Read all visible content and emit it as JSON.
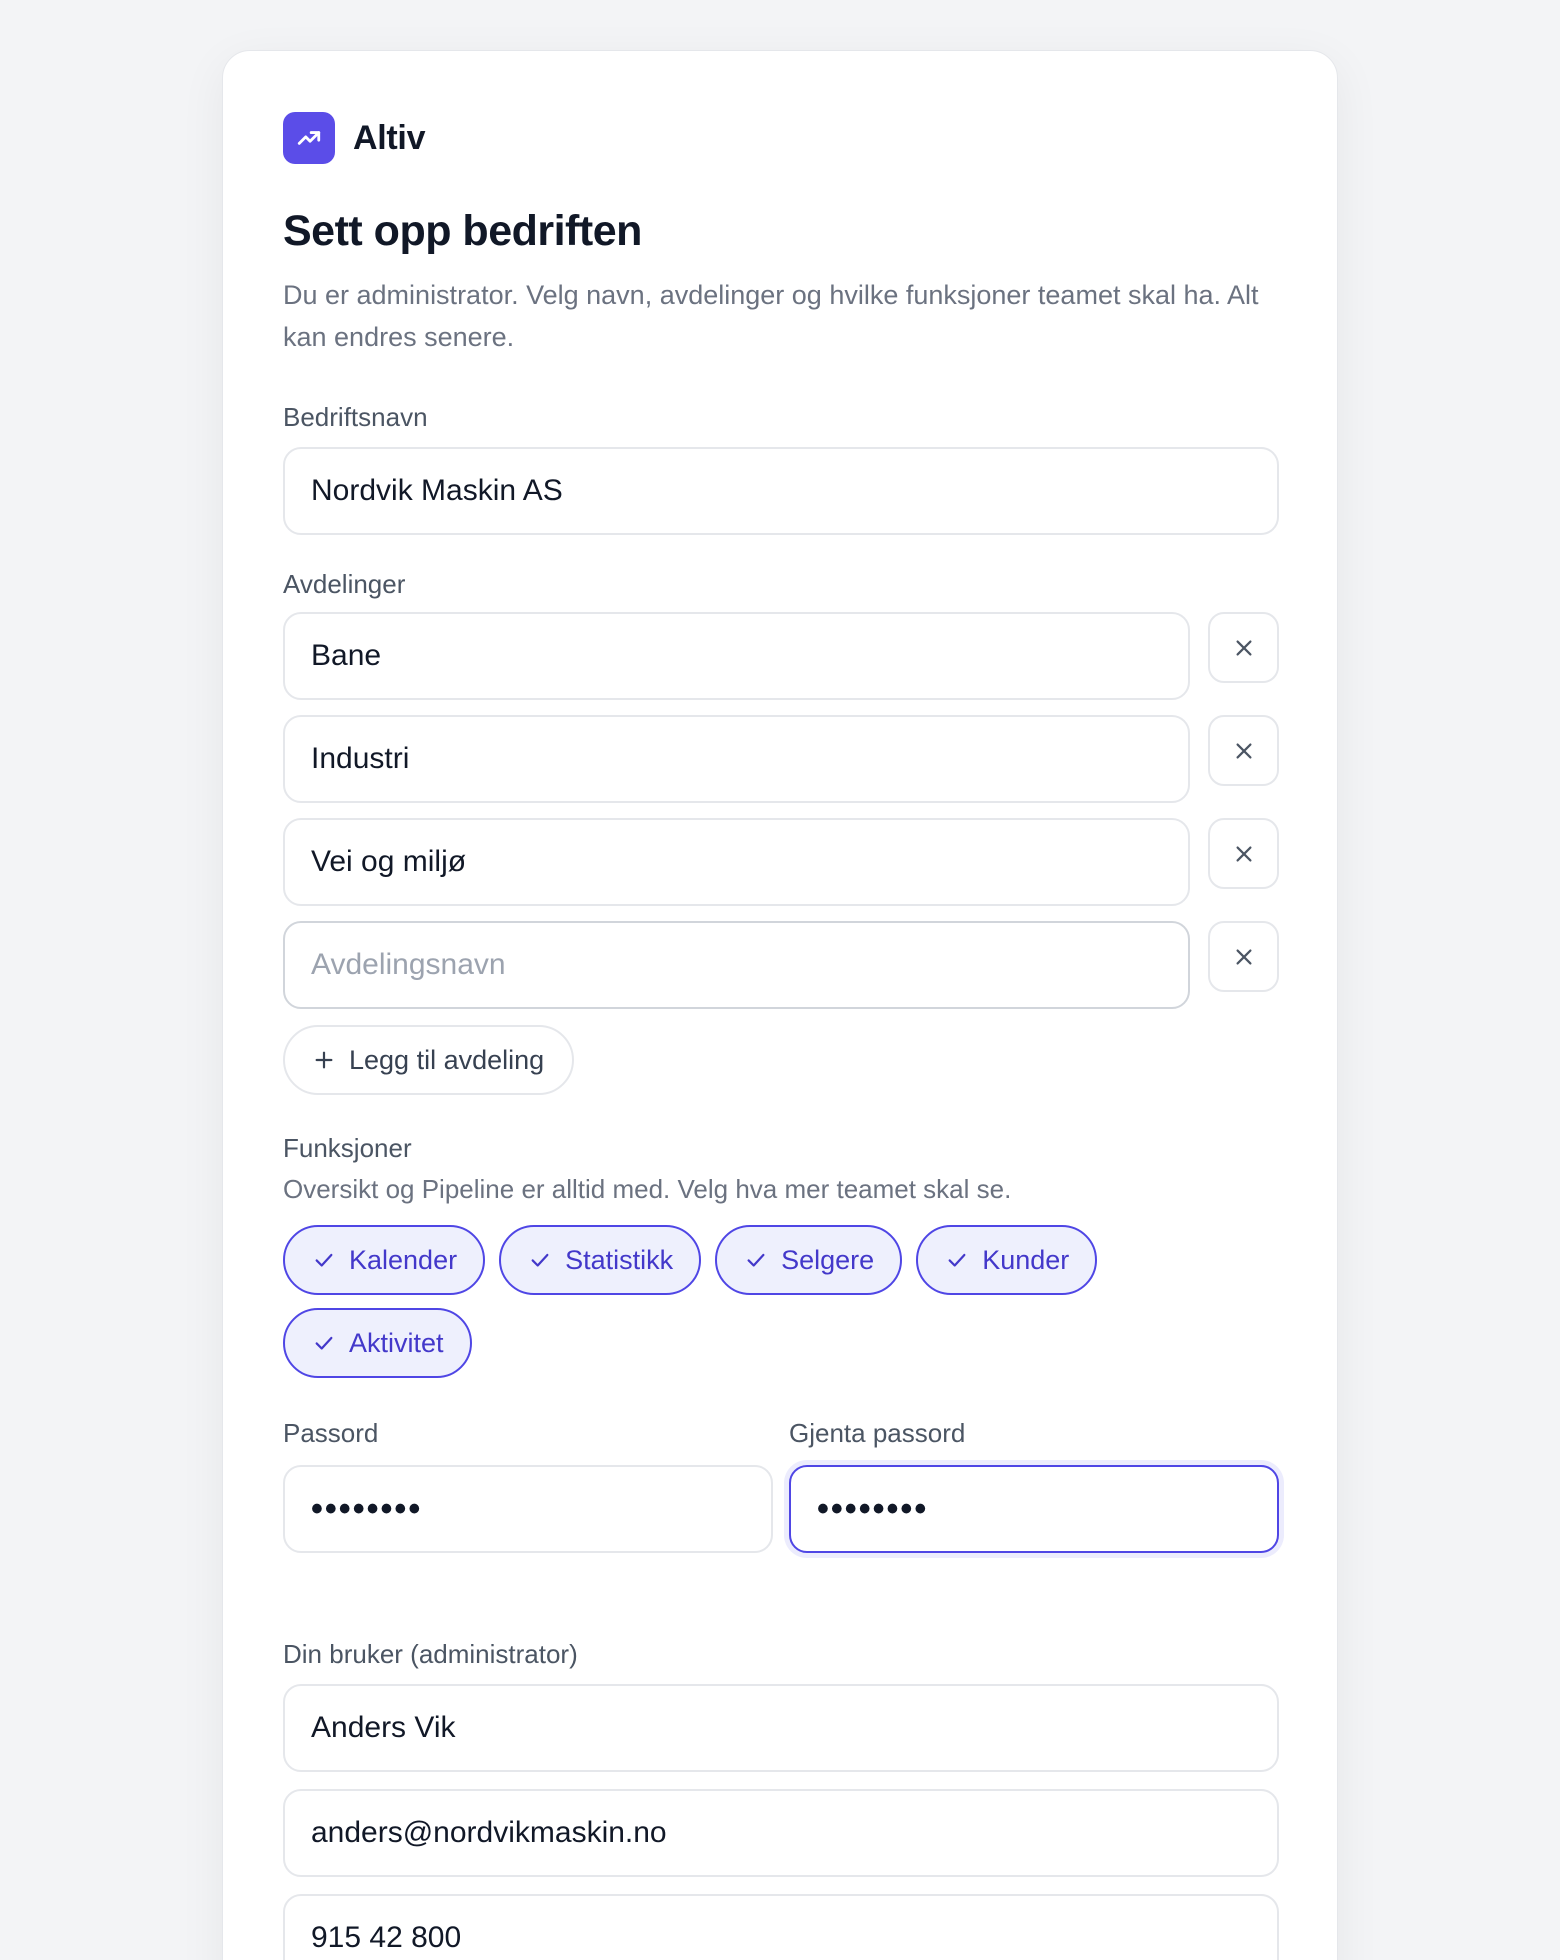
{
  "brand": {
    "name": "Altiv",
    "logo_icon": "trending-up-icon",
    "accent": "#5b4de8"
  },
  "header": {
    "title": "Sett opp bedriften",
    "subtitle": "Du er administrator. Velg navn, avdelinger og hvilke funksjoner teamet skal ha. Alt kan endres senere."
  },
  "company": {
    "label": "Bedriftsnavn",
    "value": "Nordvik Maskin AS"
  },
  "departments": {
    "label": "Avdelinger",
    "items": [
      {
        "value": "Bane"
      },
      {
        "value": "Industri"
      },
      {
        "value": "Vei og miljø"
      },
      {
        "value": "",
        "placeholder": "Avdelingsnavn"
      }
    ],
    "add_label": "Legg til avdeling"
  },
  "features": {
    "label": "Funksjoner",
    "hint": "Oversikt og Pipeline er alltid med. Velg hva mer teamet skal se.",
    "chips": [
      {
        "label": "Kalender",
        "selected": true
      },
      {
        "label": "Statistikk",
        "selected": true
      },
      {
        "label": "Selgere",
        "selected": true
      },
      {
        "label": "Kunder",
        "selected": true
      },
      {
        "label": "Aktivitet",
        "selected": true
      }
    ]
  },
  "password": {
    "label": "Passord",
    "value": "••••••••",
    "repeat_label": "Gjenta passord",
    "repeat_value": "••••••••"
  },
  "admin_user": {
    "label": "Din bruker (administrator)",
    "name": "Anders Vik",
    "email": "anders@nordvikmaskin.no",
    "phone": "915 42 800"
  },
  "colors": {
    "accent": "#4f46e5",
    "chip_bg": "#eef0fd",
    "page_bg": "#f3f4f6"
  }
}
